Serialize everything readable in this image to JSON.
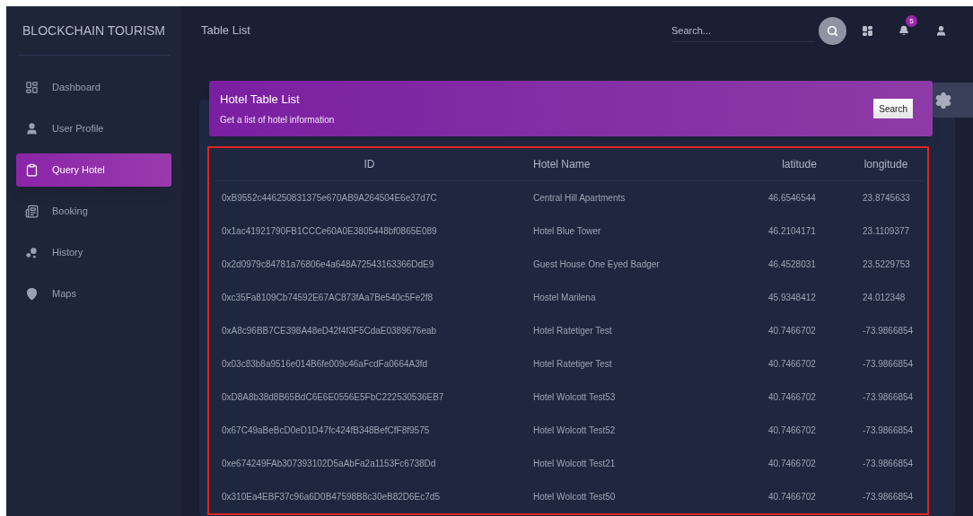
{
  "brand": "BLOCKCHAIN TOURISM",
  "sidebar": {
    "items": [
      {
        "label": "Dashboard",
        "selected": false
      },
      {
        "label": "User Profile",
        "selected": false
      },
      {
        "label": "Query Hotel",
        "selected": true
      },
      {
        "label": "Booking",
        "selected": false
      },
      {
        "label": "History",
        "selected": false
      },
      {
        "label": "Maps",
        "selected": false
      }
    ]
  },
  "header": {
    "title": "Table List",
    "search": {
      "placeholder": "Search..."
    },
    "notifications": "5"
  },
  "card": {
    "title": "Hotel Table List",
    "subtitle": "Get a list of hotel information",
    "button": "Search"
  },
  "table": {
    "columns": [
      "ID",
      "Hotel Name",
      "latitude",
      "longitude"
    ],
    "rows": [
      [
        "0xB9552c446250831375e670AB9A264504E6e37d7C",
        "Central Hill Apartments",
        "46.6546544",
        "23.8745633"
      ],
      [
        "0x1ac41921790FB1CCCe60A0E3805448bf0865E089",
        "Hotel Blue Tower",
        "46.2104171",
        "23.1109377"
      ],
      [
        "0x2d0979c84781a76806e4a648A72543163366DdE9",
        "Guest House One Eyed Badger",
        "46.4528031",
        "23.5229753"
      ],
      [
        "0xc35Fa8109Cb74592E67AC873fAa7Be540c5Fe2f8",
        "Hostel Marilena",
        "45.9348412",
        "24.012348"
      ],
      [
        "0xA8c96BB7CE398A48eD42f4f3F5CdaE0389676eab",
        "Hotel Ratetiger Test",
        "40.7466702",
        "-73.9866854"
      ],
      [
        "0x03c83b8a9516e014B6fe009c46aFcdFa0664A3fd",
        "Hotel Ratetiger Test",
        "40.7466702",
        "-73.9866854"
      ],
      [
        "0xD8A8b38d8B65BdC6E6E0556E5FbC222530536EB7",
        "Hotel Wolcott Test53",
        "40.7466702",
        "-73.9866854"
      ],
      [
        "0x67C49aBeBcD0eD1D47fc424fB348BefCfF8f9575",
        "Hotel Wolcott Test52",
        "40.7466702",
        "-73.9866854"
      ],
      [
        "0xe674249FAb307393102D5aAbFa2a1153Fc6738Dd",
        "Hotel Wolcott Test21",
        "40.7466702",
        "-73.9866854"
      ],
      [
        "0x310Ea4EBF37c96a6D0B47598B8c30eB82D6Ec7d5",
        "Hotel Wolcott Test50",
        "40.7466702",
        "-73.9866854"
      ]
    ]
  }
}
